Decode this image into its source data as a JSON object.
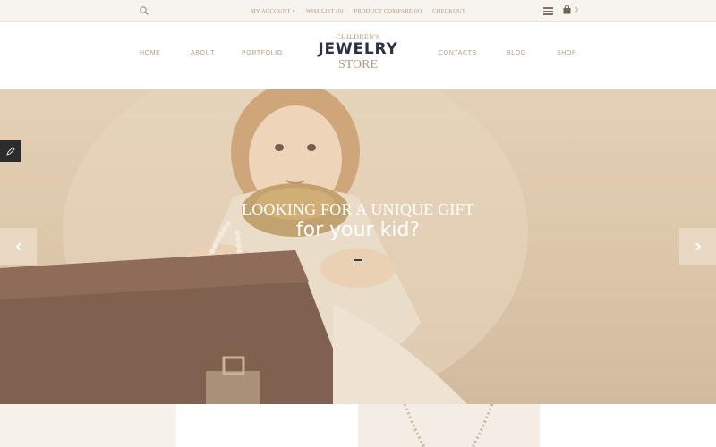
{
  "topbar": {
    "links": [
      "MY ACCOUNT",
      "WISHLIST (0)",
      "PRODUCT COMPARE (0)",
      "CHECKOUT"
    ],
    "account_caret": "▾",
    "cart_count": "0",
    "icons": [
      "search-icon",
      "menu-icon",
      "cart-icon"
    ]
  },
  "nav": {
    "left": [
      "HOME",
      "ABOUT",
      "PORTFOLIO"
    ],
    "right": [
      "CONTACTS",
      "BLOG",
      "SHOP"
    ]
  },
  "logo": {
    "line1": "CHILDREN'S",
    "line2": "JEWELRY",
    "line3": "STORE"
  },
  "hero": {
    "headline": "LOOKING FOR A UNIQUE GIFT",
    "subline": "for your kid?",
    "prev_icon": "chevron-left-icon",
    "next_icon": "chevron-right-icon",
    "edit_icon": "pencil-icon"
  },
  "colors": {
    "accent": "#b39a7d",
    "logo_dark": "#2f3048",
    "topbar_bg": "#f7f3ee"
  }
}
